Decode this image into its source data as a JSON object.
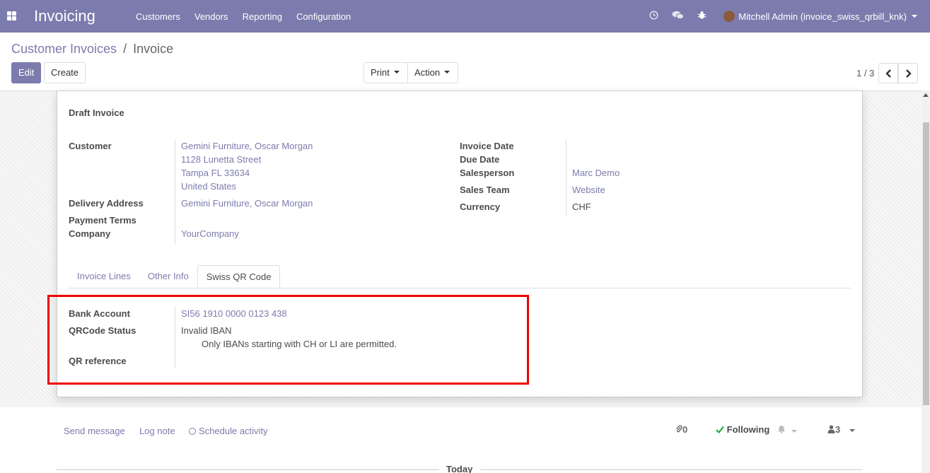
{
  "navbar": {
    "brand": "Invoicing",
    "menu": [
      "Customers",
      "Vendors",
      "Reporting",
      "Configuration"
    ],
    "user": "Mitchell Admin (invoice_swiss_qrbill_knk)"
  },
  "breadcrumb": {
    "parent": "Customer Invoices",
    "sep": "/",
    "current": "Invoice"
  },
  "buttons": {
    "edit": "Edit",
    "create": "Create",
    "print": "Print",
    "action": "Action"
  },
  "pager": {
    "value": "1 / 3"
  },
  "form": {
    "status": "Draft Invoice",
    "customer_label": "Customer",
    "customer_lines": [
      "Gemini Furniture, Oscar Morgan",
      "1128 Lunetta Street",
      "Tampa FL 33634",
      "United States"
    ],
    "delivery_label": "Delivery Address",
    "delivery_value": "Gemini Furniture, Oscar Morgan",
    "payment_terms_label": "Payment Terms",
    "company_label": "Company",
    "company_value": "YourCompany",
    "invoice_date_label": "Invoice Date",
    "due_date_label": "Due Date",
    "salesperson_label": "Salesperson",
    "salesperson_value": "Marc Demo",
    "sales_team_label": "Sales Team",
    "sales_team_value": "Website",
    "currency_label": "Currency",
    "currency_value": "CHF"
  },
  "tabs": [
    "Invoice Lines",
    "Other Info",
    "Swiss QR Code"
  ],
  "qr": {
    "bank_account_label": "Bank Account",
    "bank_account_value": "SI56 1910 0000 0123 438",
    "status_label": "QRCode Status",
    "status_value": "Invalid IBAN",
    "status_detail": "Only IBANs starting with CH or LI are permitted.",
    "reference_label": "QR reference"
  },
  "chatter": {
    "send_message": "Send message",
    "log_note": "Log note",
    "schedule_activity": "Schedule activity",
    "attachments": "0",
    "following": "Following",
    "followers": "3",
    "today": "Today"
  },
  "colors": {
    "primary": "#7c7bad",
    "highlight": "#ee0000"
  }
}
